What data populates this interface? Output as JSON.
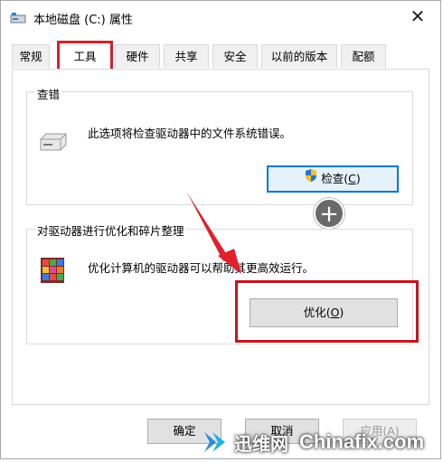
{
  "window": {
    "title": "本地磁盘 (C:) 属性",
    "close_glyph": "✕"
  },
  "tabs": [
    {
      "label": "常规",
      "active": false
    },
    {
      "label": "工具",
      "active": true
    },
    {
      "label": "硬件",
      "active": false
    },
    {
      "label": "共享",
      "active": false
    },
    {
      "label": "安全",
      "active": false
    },
    {
      "label": "以前的版本",
      "active": false
    },
    {
      "label": "配额",
      "active": false
    }
  ],
  "error_check": {
    "group_title": "查错",
    "description": "此选项将检查驱动器中的文件系统错误。",
    "button_label": "检查(",
    "button_accel": "C",
    "button_tail": ")"
  },
  "optimize": {
    "group_title": "对驱动器进行优化和碎片整理",
    "description": "优化计算机的驱动器可以帮助其更高效运行。",
    "button_label": "优化(",
    "button_accel": "O",
    "button_tail": ")"
  },
  "bottom_buttons": {
    "ok": "确定",
    "cancel": "取消",
    "apply": "应用(A)"
  },
  "watermark": {
    "cn": "迅维网",
    "en": "Chinafix.com"
  },
  "colors": {
    "highlight_red": "#d3212c",
    "focus_blue": "#0078d7"
  },
  "icons": [
    "drive-icon",
    "shield-icon",
    "defrag-icon",
    "plus-icon",
    "close-icon"
  ]
}
